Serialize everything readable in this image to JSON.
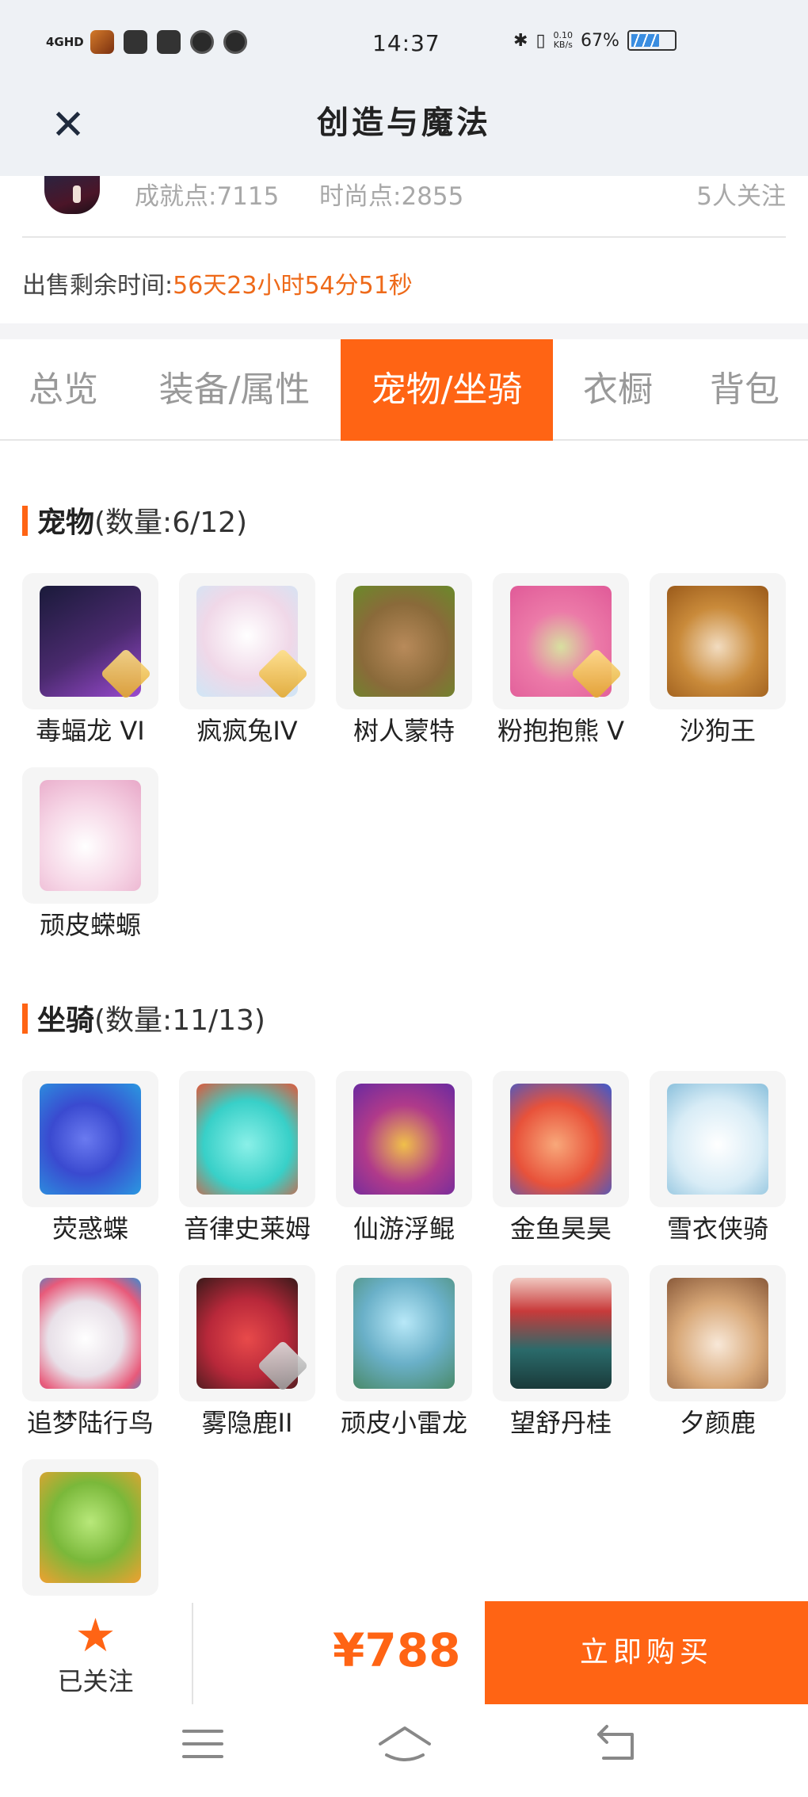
{
  "status_bar": {
    "network": "4GHD",
    "time": "14:37",
    "speed": "0.10",
    "speed_unit": "KB/s",
    "battery": "67%",
    "app_icons": [
      "game-app-icon",
      "taobao-icon",
      "app-icon",
      "video-icon",
      "video-icon"
    ]
  },
  "header": {
    "title": "创造与魔法"
  },
  "profile": {
    "achievement": "成就点:7115",
    "fashion": "时尚点:2855",
    "followers": "5人关注"
  },
  "sale": {
    "label": "出售剩余时间:",
    "remaining": "56天23小时54分51秒"
  },
  "tabs": [
    {
      "label": "总览",
      "active": false
    },
    {
      "label": "装备/属性",
      "active": false
    },
    {
      "label": "宠物/坐骑",
      "active": true
    },
    {
      "label": "衣橱",
      "active": false
    },
    {
      "label": "背包",
      "active": false
    }
  ],
  "pets": {
    "title": "宠物",
    "count": "(数量:6/12)",
    "items": [
      {
        "name": "毒蝠龙 VI",
        "color": "#4a2a6e"
      },
      {
        "name": "疯疯兔IV",
        "color": "#f0d8e8"
      },
      {
        "name": "树人蒙特",
        "color": "#8a6a3a"
      },
      {
        "name": "粉抱抱熊 V",
        "color": "#ec7aa8"
      },
      {
        "name": "沙狗王",
        "color": "#c98a3a"
      },
      {
        "name": "顽皮蝾螈",
        "color": "#f6d6e6"
      }
    ]
  },
  "mounts": {
    "title": "坐骑",
    "count": "(数量:11/13)",
    "items": [
      {
        "name": "荧惑蝶",
        "color": "#3a4ad0"
      },
      {
        "name": "音律史莱姆",
        "color": "#38d0c8"
      },
      {
        "name": "仙游浮鲲",
        "color": "#b03a8a"
      },
      {
        "name": "金鱼昊昊",
        "color": "#e8523a"
      },
      {
        "name": "雪衣侠骑",
        "color": "#d8ecf6"
      },
      {
        "name": "追梦陆行鸟",
        "color": "#e8e0e8"
      },
      {
        "name": "雾隐鹿II",
        "color": "#b8283a"
      },
      {
        "name": "顽皮小雷龙",
        "color": "#6ab0c8"
      },
      {
        "name": "望舒丹桂",
        "color": "#2a6a6a"
      },
      {
        "name": "夕颜鹿",
        "color": "#d8a878"
      },
      {
        "name": "",
        "color": "#7ab83a"
      }
    ]
  },
  "bottom": {
    "follow_label": "已关注",
    "price": "¥788",
    "buy_label": "立即购买"
  }
}
